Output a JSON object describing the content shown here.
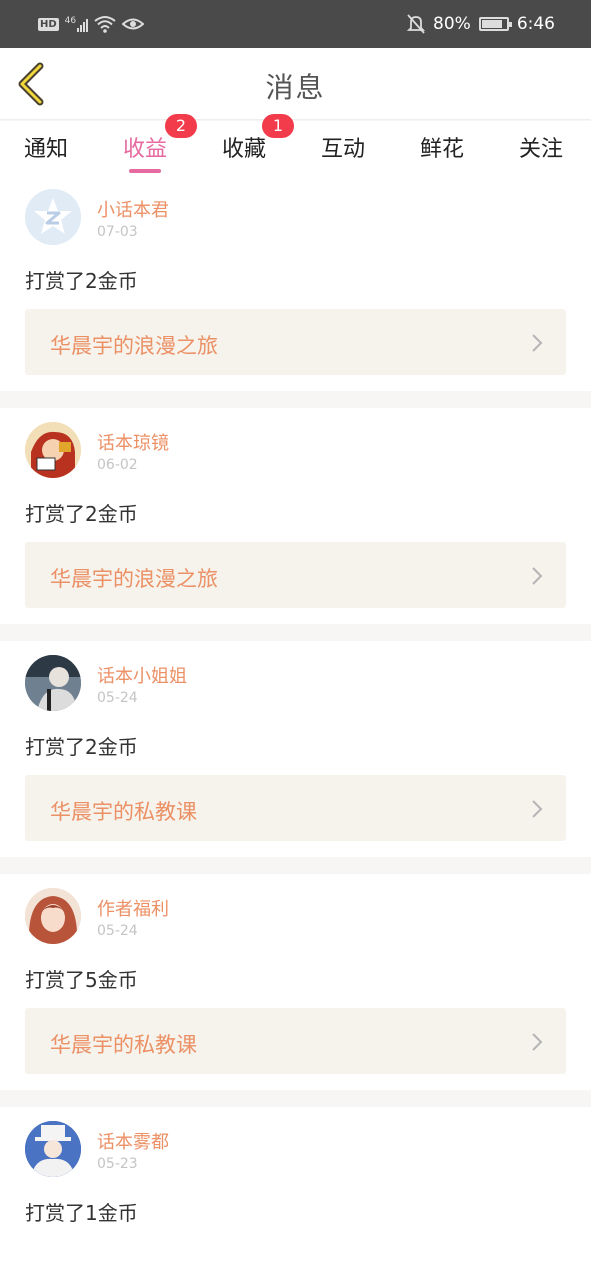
{
  "status_bar": {
    "network": "HD",
    "signal_type": "46",
    "battery": "80%",
    "time": "6:46"
  },
  "header": {
    "title": "消息"
  },
  "tabs": [
    {
      "label": "通知",
      "badge": "",
      "active": false
    },
    {
      "label": "收益",
      "badge": "2",
      "active": true
    },
    {
      "label": "收藏",
      "badge": "1",
      "active": false
    },
    {
      "label": "互动",
      "badge": "",
      "active": false
    },
    {
      "label": "鲜花",
      "badge": "",
      "active": false
    },
    {
      "label": "关注",
      "badge": "",
      "active": false
    }
  ],
  "feed": [
    {
      "name": "小话本君",
      "date": "07-03",
      "message": "打赏了2金币",
      "book": "华晨宇的浪漫之旅"
    },
    {
      "name": "话本琼镜",
      "date": "06-02",
      "message": "打赏了2金币",
      "book": "华晨宇的浪漫之旅"
    },
    {
      "name": "话本小姐姐",
      "date": "05-24",
      "message": "打赏了2金币",
      "book": "华晨宇的私教课"
    },
    {
      "name": "作者福利",
      "date": "05-24",
      "message": "打赏了5金币",
      "book": "华晨宇的私教课"
    },
    {
      "name": "话本雾都",
      "date": "05-23",
      "message": "打赏了1金币",
      "book": ""
    }
  ],
  "colors": {
    "accent": "#e66aa0",
    "name": "#ec9066",
    "badge": "#f23b4b",
    "book_bg": "#f5f3ec",
    "status_bar": "#4a4a4a"
  }
}
